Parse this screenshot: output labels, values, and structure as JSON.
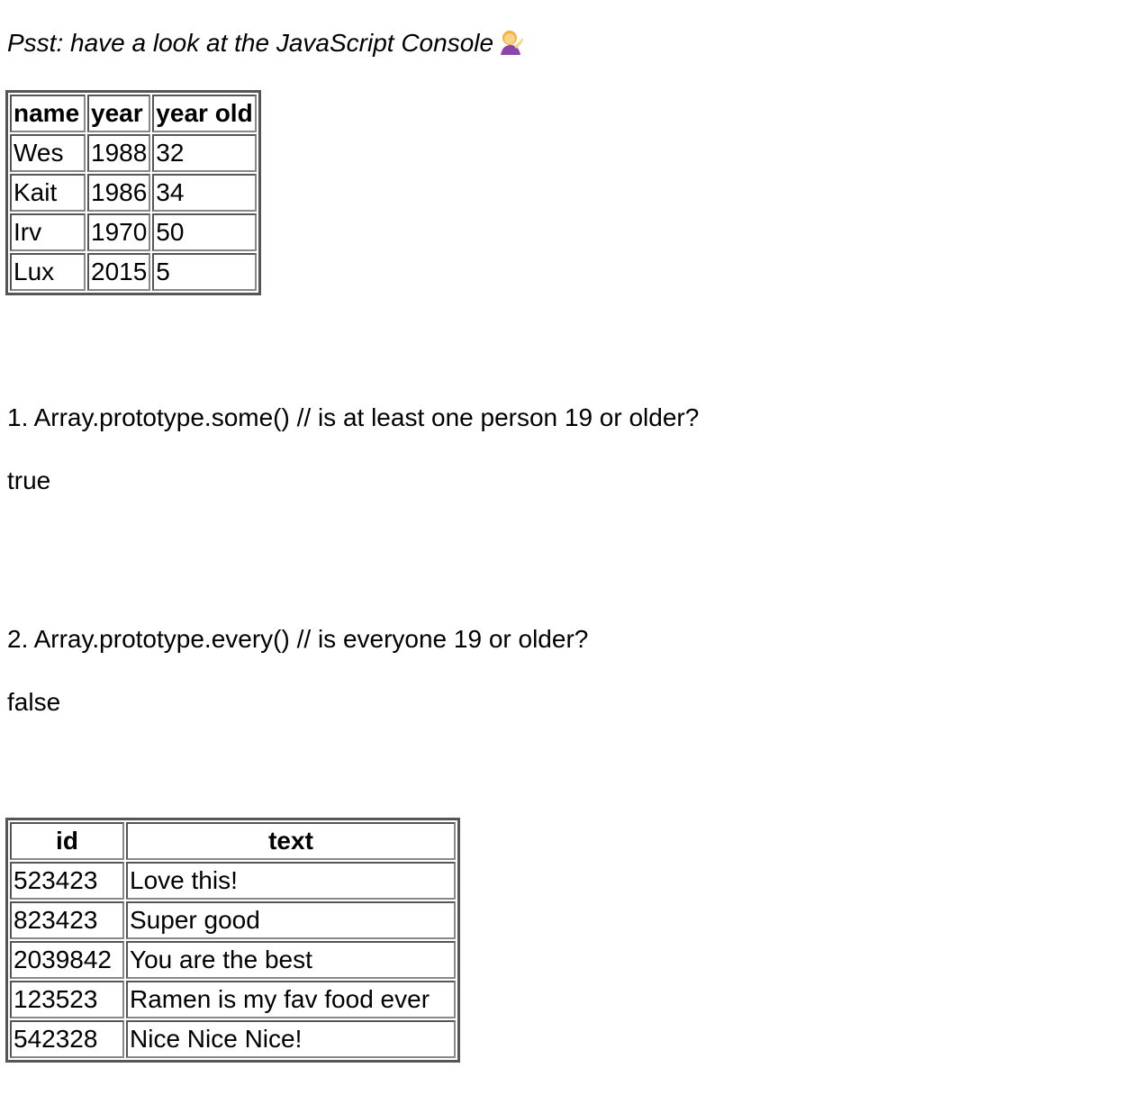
{
  "intro": {
    "text": "Psst: have a look at the JavaScript Console",
    "emoji": "💁"
  },
  "people_table": {
    "headers": [
      "name",
      "year",
      "year old"
    ],
    "rows": [
      [
        "Wes",
        "1988",
        "32"
      ],
      [
        "Kait",
        "1986",
        "34"
      ],
      [
        "Irv",
        "1970",
        "50"
      ],
      [
        "Lux",
        "2015",
        "5"
      ]
    ]
  },
  "questions": [
    {
      "text": "1. Array.prototype.some() // is at least one person 19 or older?",
      "answer": "true"
    },
    {
      "text": "2. Array.prototype.every() // is everyone 19 or older?",
      "answer": "false"
    }
  ],
  "comments_table": {
    "headers": [
      "id",
      "text"
    ],
    "rows": [
      [
        "523423",
        "Love this!"
      ],
      [
        "823423",
        "Super good"
      ],
      [
        "2039842",
        "You are the best"
      ],
      [
        "123523",
        "Ramen is my fav food ever"
      ],
      [
        "542328",
        "Nice Nice Nice!"
      ]
    ]
  }
}
